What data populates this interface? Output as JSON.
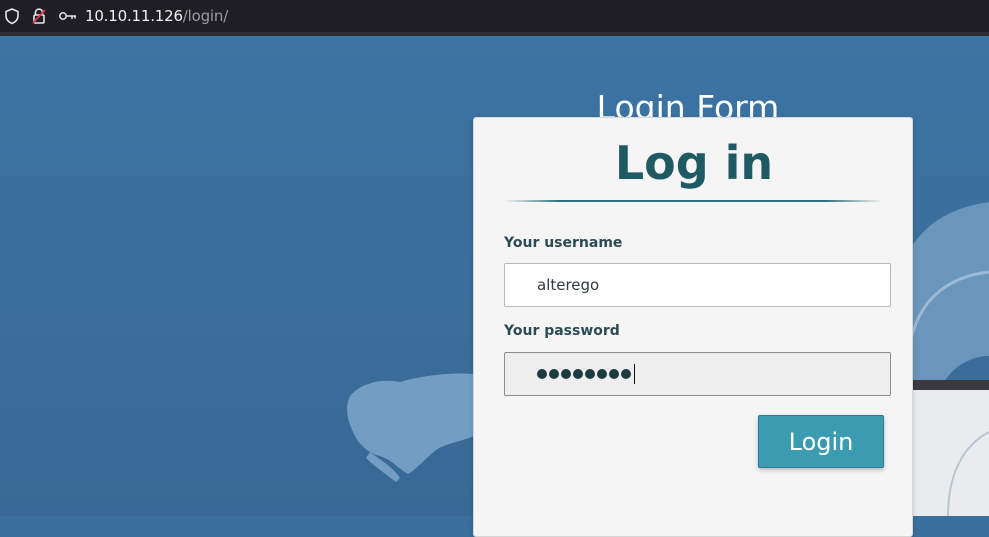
{
  "browser": {
    "url_host": "10.10.11.126",
    "url_path": "/login/",
    "icons": [
      "shield-icon",
      "insecure-lock-icon",
      "key-icon"
    ]
  },
  "page": {
    "title": "Login Form",
    "background_color": "#3b6f9c"
  },
  "form": {
    "heading": "Log in",
    "username_label": "Your username",
    "username_value": "alterego",
    "password_label": "Your password",
    "password_masked_length": 8,
    "submit_label": "Login",
    "accent_color": "#3a9bb1",
    "heading_color": "#1f5a63"
  }
}
